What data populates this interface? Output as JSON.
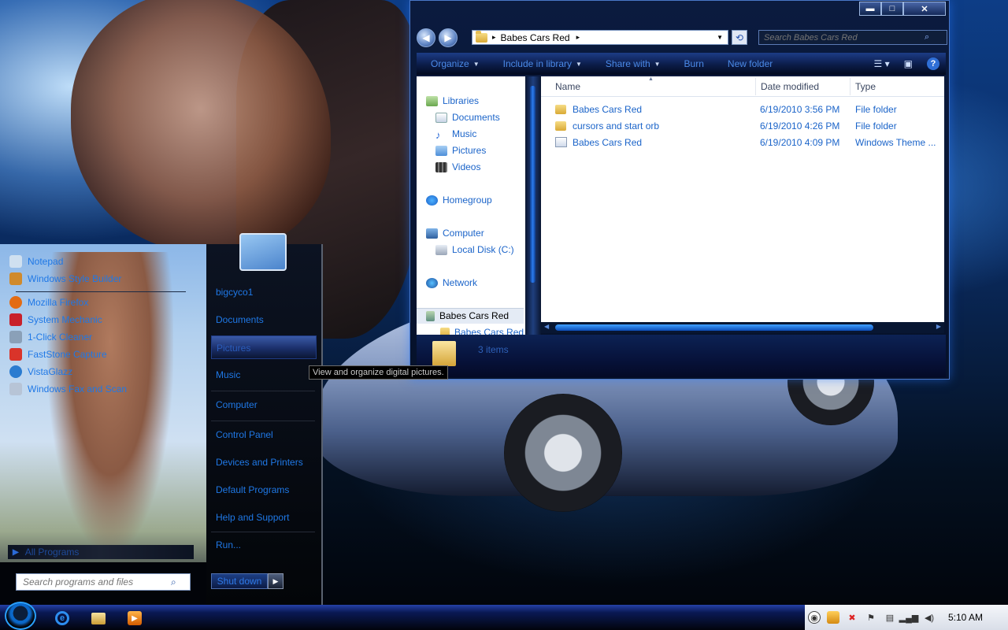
{
  "explorer": {
    "window_controls": {
      "minimize": "▬",
      "maximize": "□",
      "close": "✕"
    },
    "address": {
      "segment": "Babes Cars Red",
      "arrow": "▸"
    },
    "search_placeholder": "Search Babes Cars Red",
    "toolbar": {
      "organize": "Organize",
      "include_in_library": "Include in library",
      "share_with": "Share with",
      "burn": "Burn",
      "new_folder": "New folder"
    },
    "nav": {
      "libraries": "Libraries",
      "documents": "Documents",
      "music": "Music",
      "pictures": "Pictures",
      "videos": "Videos",
      "homegroup": "Homegroup",
      "computer": "Computer",
      "local_disk": "Local Disk (C:)",
      "network": "Network",
      "selected_folder": "Babes Cars Red",
      "sub_folder": "Babes Cars Red"
    },
    "columns": {
      "name": "Name",
      "date_modified": "Date modified",
      "type": "Type"
    },
    "files": [
      {
        "name": "Babes Cars Red",
        "date": "6/19/2010 3:56 PM",
        "type": "File folder"
      },
      {
        "name": "cursors and start orb",
        "date": "6/19/2010 4:26 PM",
        "type": "File folder"
      },
      {
        "name": "Babes Cars Red",
        "date": "6/19/2010 4:09 PM",
        "type": "Windows Theme ..."
      }
    ],
    "status": "3 items"
  },
  "start_menu": {
    "programs": [
      {
        "label": "Notepad",
        "icon": "notepad-icon",
        "color": "#cfe0f0"
      },
      {
        "label": "Windows Style Builder",
        "icon": "style-builder-icon",
        "color": "#d08a2c"
      },
      {
        "label": "Mozilla Firefox",
        "icon": "firefox-icon",
        "color": "#e36b12"
      },
      {
        "label": "System Mechanic",
        "icon": "system-mechanic-icon",
        "color": "#c8202a"
      },
      {
        "label": "1-Click Cleaner",
        "icon": "cleaner-icon",
        "color": "#8aa0b8"
      },
      {
        "label": "FastStone Capture",
        "icon": "faststone-icon",
        "color": "#d9342a"
      },
      {
        "label": "VistaGlazz",
        "icon": "vistaglazz-icon",
        "color": "#2a7bd0"
      },
      {
        "label": "Windows Fax and Scan",
        "icon": "fax-scan-icon",
        "color": "#b7c4d6"
      }
    ],
    "all_programs": "All Programs",
    "search_placeholder": "Search programs and files",
    "right_links": {
      "user": "bigcyco1",
      "documents": "Documents",
      "pictures": "Pictures",
      "music": "Music",
      "computer": "Computer",
      "control_panel": "Control Panel",
      "devices_printers": "Devices and Printers",
      "default_programs": "Default Programs",
      "help_support": "Help and Support",
      "run": "Run..."
    },
    "shutdown": "Shut down",
    "shutdown_arrow": "▶"
  },
  "tooltip": "View and organize digital pictures.",
  "taskbar": {
    "clock": "5:10 AM",
    "pinned": [
      "internet-explorer-icon",
      "file-explorer-icon",
      "media-player-icon"
    ]
  }
}
